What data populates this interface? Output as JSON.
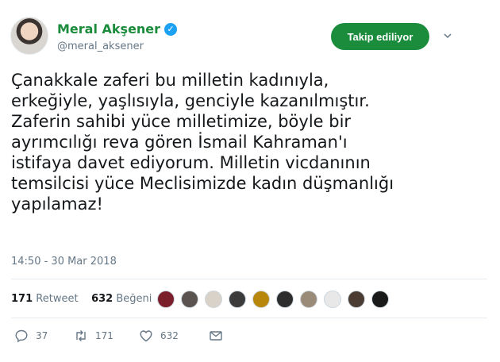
{
  "author": {
    "name": "Meral Akşener",
    "handle": "@meral_aksener",
    "verified_icon": "verified-badge-icon",
    "name_color": "#1b8c3c"
  },
  "follow_button": {
    "label": "Takip ediliyor",
    "color": "#1b8c3c"
  },
  "tweet": {
    "lines": [
      "Çanakkale zaferi bu milletin kadınıyla,",
      "erkeğiyle, yaşlısıyla, genciyle kazanılmıştır.",
      "Zaferin sahibi yüce milletimize, böyle bir",
      "ayrımcılığı reva gören İsmail Kahraman'ı",
      "istifaya davet ediyorum. Milletin vicdanının",
      "temsilcisi yüce Meclisimizde kadın düşmanlığı",
      "yapılamaz!"
    ],
    "timestamp": "14:50 - 30 Mar 2018"
  },
  "stats": {
    "retweets_count": "171",
    "retweets_label": "Retweet",
    "likes_count": "632",
    "likes_label": "Beğeni"
  },
  "likers": [
    {
      "color": "#7a1f2b"
    },
    {
      "color": "#5a5350"
    },
    {
      "color": "#d8d2c8"
    },
    {
      "color": "#3b3b3b"
    },
    {
      "color": "#b8860b"
    },
    {
      "color": "#2d2d2d"
    },
    {
      "color": "#9a8a78"
    },
    {
      "color": "#e8e8e8"
    },
    {
      "color": "#4a3b33"
    },
    {
      "color": "#1a1a1a"
    }
  ],
  "actions": {
    "reply_count": "37",
    "retweet_count": "171",
    "like_count": "632"
  },
  "colors": {
    "muted": "#657786",
    "divider": "#e6ecf0",
    "verified": "#1da1f2"
  }
}
